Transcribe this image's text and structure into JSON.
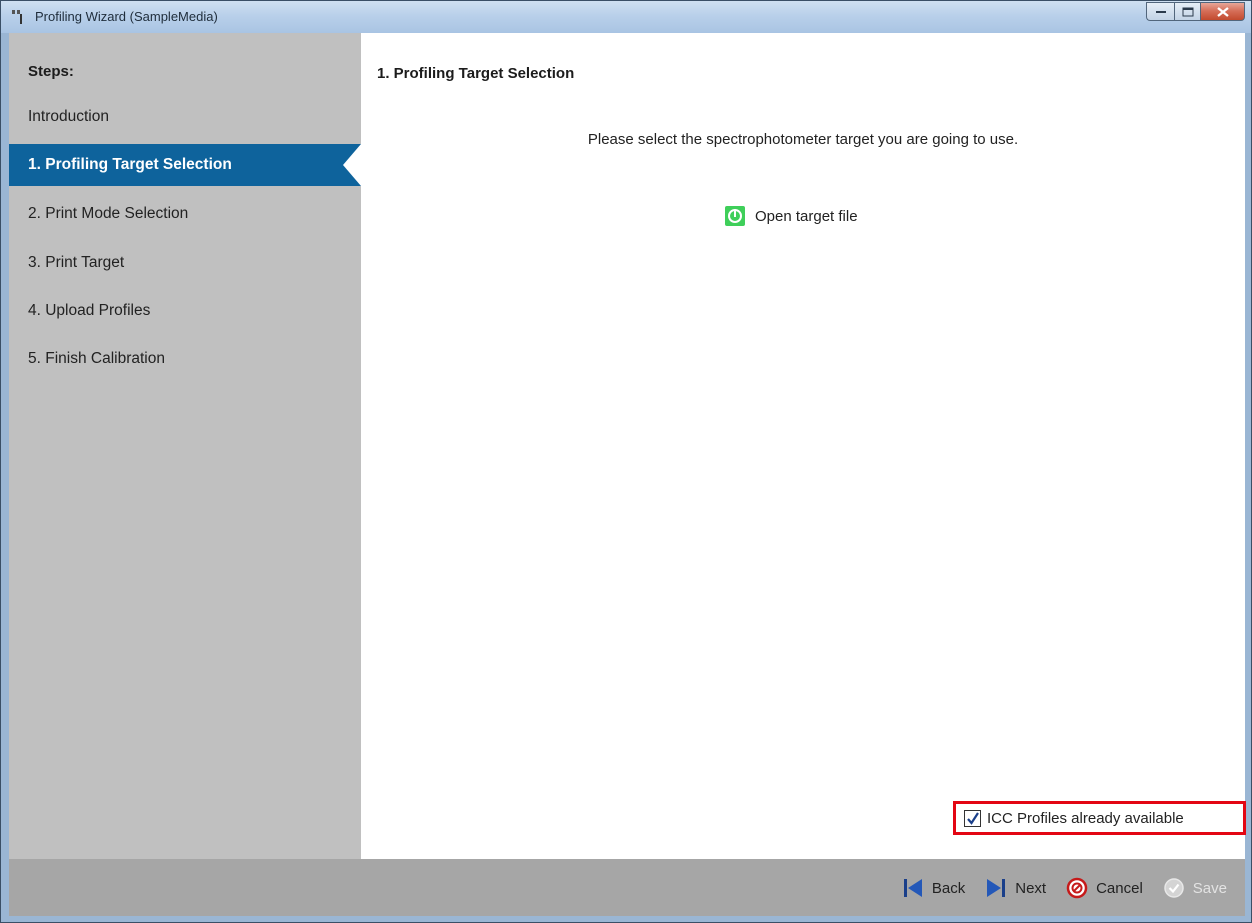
{
  "window": {
    "title": "Profiling Wizard (SampleMedia)"
  },
  "sidebar": {
    "heading": "Steps:",
    "items": [
      {
        "label": "Introduction",
        "active": false
      },
      {
        "label": "1. Profiling Target Selection",
        "active": true
      },
      {
        "label": "2. Print Mode Selection",
        "active": false
      },
      {
        "label": "3. Print Target",
        "active": false
      },
      {
        "label": "4. Upload Profiles",
        "active": false
      },
      {
        "label": "5. Finish Calibration",
        "active": false
      }
    ]
  },
  "main": {
    "title": "1. Profiling Target Selection",
    "instruction": "Please select the spectrophotometer target you are going to use.",
    "open_target": {
      "label": "Open target file",
      "icon": "open-file-icon"
    },
    "icc_option": {
      "label": "ICC Profiles already available",
      "checked": true
    }
  },
  "footer": {
    "back_label": "Back",
    "next_label": "Next",
    "cancel_label": "Cancel",
    "save_label": "Save",
    "save_enabled": false
  },
  "colors": {
    "accent": "#0e639c",
    "sidebar_bg": "#c0c0c0",
    "footer_bg": "#a6a6a6",
    "highlight_border": "#e30613",
    "open_icon_green": "#3fcf5a"
  }
}
